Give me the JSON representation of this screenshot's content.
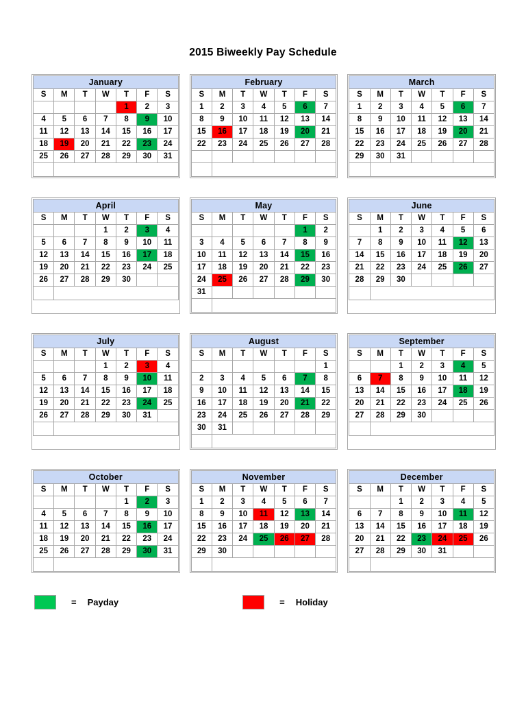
{
  "title": "2015 Biweekly Pay Schedule",
  "weekday_headers": [
    "S",
    "M",
    "T",
    "W",
    "T",
    "F",
    "S"
  ],
  "legend": {
    "payday": {
      "label": "Payday",
      "equals": "=",
      "color": "#00c853"
    },
    "holiday": {
      "label": "Holiday",
      "equals": "=",
      "color": "#ff0000"
    }
  },
  "months": [
    {
      "name": "January",
      "first_weekday": 4,
      "days_in_month": 31,
      "paydays": [
        9,
        23
      ],
      "holidays": [
        1,
        19
      ],
      "weeks": [
        [
          "",
          "",
          "",
          "",
          "1",
          "2",
          "3"
        ],
        [
          "4",
          "5",
          "6",
          "7",
          "8",
          "9",
          "10"
        ],
        [
          "11",
          "12",
          "13",
          "14",
          "15",
          "16",
          "17"
        ],
        [
          "18",
          "19",
          "20",
          "21",
          "22",
          "23",
          "24"
        ],
        [
          "25",
          "26",
          "27",
          "28",
          "29",
          "30",
          "31"
        ]
      ]
    },
    {
      "name": "February",
      "first_weekday": 0,
      "days_in_month": 28,
      "paydays": [
        6,
        20
      ],
      "holidays": [
        16
      ],
      "weeks": [
        [
          "1",
          "2",
          "3",
          "4",
          "5",
          "6",
          "7"
        ],
        [
          "8",
          "9",
          "10",
          "11",
          "12",
          "13",
          "14"
        ],
        [
          "15",
          "16",
          "17",
          "18",
          "19",
          "20",
          "21"
        ],
        [
          "22",
          "23",
          "24",
          "25",
          "26",
          "27",
          "28"
        ],
        [
          "",
          "",
          "",
          "",
          "",
          "",
          ""
        ]
      ]
    },
    {
      "name": "March",
      "first_weekday": 0,
      "days_in_month": 31,
      "paydays": [
        6,
        20
      ],
      "holidays": [],
      "weeks": [
        [
          "1",
          "2",
          "3",
          "4",
          "5",
          "6",
          "7"
        ],
        [
          "8",
          "9",
          "10",
          "11",
          "12",
          "13",
          "14"
        ],
        [
          "15",
          "16",
          "17",
          "18",
          "19",
          "20",
          "21"
        ],
        [
          "22",
          "23",
          "24",
          "25",
          "26",
          "27",
          "28"
        ],
        [
          "29",
          "30",
          "31",
          "",
          "",
          "",
          ""
        ]
      ]
    },
    {
      "name": "April",
      "first_weekday": 3,
      "days_in_month": 30,
      "paydays": [
        3,
        17
      ],
      "holidays": [],
      "weeks": [
        [
          "",
          "",
          "",
          "1",
          "2",
          "3",
          "4"
        ],
        [
          "5",
          "6",
          "7",
          "8",
          "9",
          "10",
          "11"
        ],
        [
          "12",
          "13",
          "14",
          "15",
          "16",
          "17",
          "18"
        ],
        [
          "19",
          "20",
          "21",
          "22",
          "23",
          "24",
          "25"
        ],
        [
          "26",
          "27",
          "28",
          "29",
          "30",
          "",
          ""
        ]
      ]
    },
    {
      "name": "May",
      "first_weekday": 5,
      "days_in_month": 31,
      "paydays": [
        1,
        15,
        29
      ],
      "holidays": [
        25
      ],
      "weeks": [
        [
          "",
          "",
          "",
          "",
          "",
          "1",
          "2"
        ],
        [
          "3",
          "4",
          "5",
          "6",
          "7",
          "8",
          "9"
        ],
        [
          "10",
          "11",
          "12",
          "13",
          "14",
          "15",
          "16"
        ],
        [
          "17",
          "18",
          "19",
          "20",
          "21",
          "22",
          "23"
        ],
        [
          "24",
          "25",
          "26",
          "27",
          "28",
          "29",
          "30"
        ],
        [
          "31",
          "",
          "",
          "",
          "",
          "",
          ""
        ]
      ]
    },
    {
      "name": "June",
      "first_weekday": 1,
      "days_in_month": 30,
      "paydays": [
        12,
        26
      ],
      "holidays": [],
      "weeks": [
        [
          "",
          "1",
          "2",
          "3",
          "4",
          "5",
          "6"
        ],
        [
          "7",
          "8",
          "9",
          "10",
          "11",
          "12",
          "13"
        ],
        [
          "14",
          "15",
          "16",
          "17",
          "18",
          "19",
          "20"
        ],
        [
          "21",
          "22",
          "23",
          "24",
          "25",
          "26",
          "27"
        ],
        [
          "28",
          "29",
          "30",
          "",
          "",
          "",
          ""
        ]
      ]
    },
    {
      "name": "July",
      "first_weekday": 3,
      "days_in_month": 31,
      "paydays": [
        10,
        24
      ],
      "holidays": [
        3
      ],
      "weeks": [
        [
          "",
          "",
          "",
          "1",
          "2",
          "3",
          "4"
        ],
        [
          "5",
          "6",
          "7",
          "8",
          "9",
          "10",
          "11"
        ],
        [
          "12",
          "13",
          "14",
          "15",
          "16",
          "17",
          "18"
        ],
        [
          "19",
          "20",
          "21",
          "22",
          "23",
          "24",
          "25"
        ],
        [
          "26",
          "27",
          "28",
          "29",
          "30",
          "31",
          ""
        ]
      ]
    },
    {
      "name": "August",
      "first_weekday": 6,
      "days_in_month": 31,
      "paydays": [
        7,
        21
      ],
      "holidays": [],
      "weeks": [
        [
          "",
          "",
          "",
          "",
          "",
          "",
          "1"
        ],
        [
          "2",
          "3",
          "4",
          "5",
          "6",
          "7",
          "8"
        ],
        [
          "9",
          "10",
          "11",
          "12",
          "13",
          "14",
          "15"
        ],
        [
          "16",
          "17",
          "18",
          "19",
          "20",
          "21",
          "22"
        ],
        [
          "23",
          "24",
          "25",
          "26",
          "27",
          "28",
          "29"
        ],
        [
          "30",
          "31",
          "",
          "",
          "",
          "",
          ""
        ]
      ]
    },
    {
      "name": "September",
      "first_weekday": 2,
      "days_in_month": 30,
      "paydays": [
        4,
        18
      ],
      "holidays": [
        7
      ],
      "weeks": [
        [
          "",
          "",
          "1",
          "2",
          "3",
          "4",
          "5"
        ],
        [
          "6",
          "7",
          "8",
          "9",
          "10",
          "11",
          "12"
        ],
        [
          "13",
          "14",
          "15",
          "16",
          "17",
          "18",
          "19"
        ],
        [
          "20",
          "21",
          "22",
          "23",
          "24",
          "25",
          "26"
        ],
        [
          "27",
          "28",
          "29",
          "30",
          "",
          "",
          ""
        ]
      ]
    },
    {
      "name": "October",
      "first_weekday": 4,
      "days_in_month": 31,
      "paydays": [
        2,
        16,
        30
      ],
      "holidays": [],
      "weeks": [
        [
          "",
          "",
          "",
          "",
          "1",
          "2",
          "3"
        ],
        [
          "4",
          "5",
          "6",
          "7",
          "8",
          "9",
          "10"
        ],
        [
          "11",
          "12",
          "13",
          "14",
          "15",
          "16",
          "17"
        ],
        [
          "18",
          "19",
          "20",
          "21",
          "22",
          "23",
          "24"
        ],
        [
          "25",
          "26",
          "27",
          "28",
          "29",
          "30",
          "31"
        ]
      ]
    },
    {
      "name": "November",
      "first_weekday": 0,
      "days_in_month": 30,
      "paydays": [
        13,
        25
      ],
      "holidays": [
        11,
        26,
        27
      ],
      "weeks": [
        [
          "1",
          "2",
          "3",
          "4",
          "5",
          "6",
          "7"
        ],
        [
          "8",
          "9",
          "10",
          "11",
          "12",
          "13",
          "14"
        ],
        [
          "15",
          "16",
          "17",
          "18",
          "19",
          "20",
          "21"
        ],
        [
          "22",
          "23",
          "24",
          "25",
          "26",
          "27",
          "28"
        ],
        [
          "29",
          "30",
          "",
          "",
          "",
          "",
          ""
        ]
      ]
    },
    {
      "name": "December",
      "first_weekday": 2,
      "days_in_month": 31,
      "paydays": [
        11,
        23
      ],
      "holidays": [
        24,
        25
      ],
      "weeks": [
        [
          "",
          "",
          "1",
          "2",
          "3",
          "4",
          "5"
        ],
        [
          "6",
          "7",
          "8",
          "9",
          "10",
          "11",
          "12"
        ],
        [
          "13",
          "14",
          "15",
          "16",
          "17",
          "18",
          "19"
        ],
        [
          "20",
          "21",
          "22",
          "23",
          "24",
          "25",
          "26"
        ],
        [
          "27",
          "28",
          "29",
          "30",
          "31",
          "",
          ""
        ]
      ]
    }
  ]
}
